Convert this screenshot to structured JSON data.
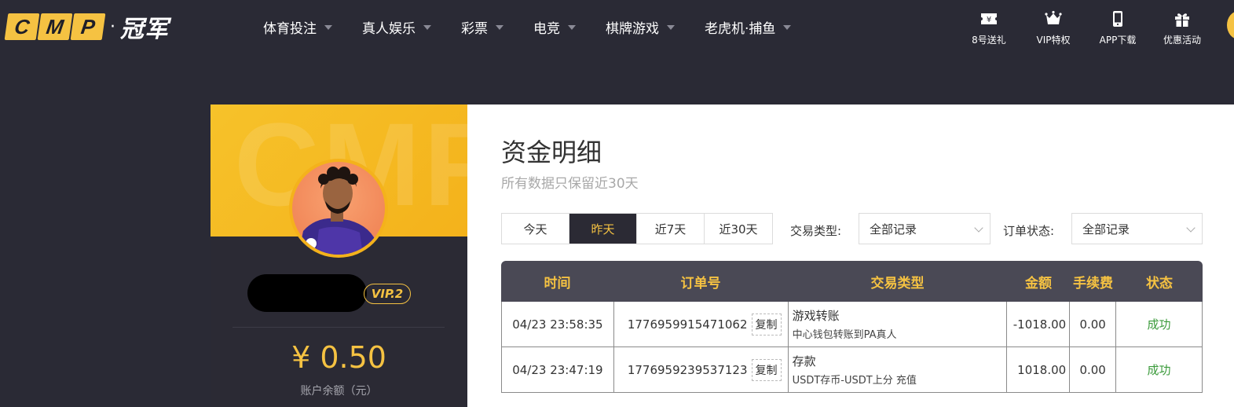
{
  "logo": {
    "letters": [
      "C",
      "M",
      "P"
    ],
    "dot": "·",
    "brand": "冠军"
  },
  "nav": [
    {
      "label": "体育投注"
    },
    {
      "label": "真人娱乐"
    },
    {
      "label": "彩票"
    },
    {
      "label": "电竞"
    },
    {
      "label": "棋牌游戏"
    },
    {
      "label": "老虎机·捕鱼"
    }
  ],
  "tools": [
    {
      "label": "8号送礼",
      "icon": "ticket-icon"
    },
    {
      "label": "VIP特权",
      "icon": "crown-icon"
    },
    {
      "label": "APP下载",
      "icon": "mobile-icon"
    },
    {
      "label": "优惠活动",
      "icon": "gift-icon"
    }
  ],
  "profile": {
    "watermark": "CMP",
    "vip": "VIP.2",
    "balance": "¥ 0.50",
    "balance_label": "账户余额（元）"
  },
  "main": {
    "title": "资金明细",
    "subtitle": "所有数据只保留近30天",
    "date_tabs": [
      {
        "label": "今天",
        "active": false
      },
      {
        "label": "昨天",
        "active": true
      },
      {
        "label": "近7天",
        "active": false
      },
      {
        "label": "近30天",
        "active": false
      }
    ],
    "filters": {
      "trade_type_label": "交易类型:",
      "trade_type_value": "全部记录",
      "order_status_label": "订单状态:",
      "order_status_value": "全部记录"
    },
    "table": {
      "headers": [
        "时间",
        "订单号",
        "交易类型",
        "金额",
        "手续费",
        "状态"
      ],
      "copy_label": "复制",
      "rows": [
        {
          "time": "04/23 23:58:35",
          "order": "1776959915471062",
          "type": "游戏转账",
          "type_detail": "中心钱包转账到PA真人",
          "amount": "-1018.00",
          "fee": "0.00",
          "status": "成功"
        },
        {
          "time": "04/23 23:47:19",
          "order": "1776959239537123",
          "type": "存款",
          "type_detail": "USDT存币-USDT上分 充值",
          "amount": "1018.00",
          "fee": "0.00",
          "status": "成功"
        }
      ]
    }
  },
  "colors": {
    "accent": "#f5c242",
    "header_bg": "#2a2a35",
    "table_head": "#4a4955",
    "success": "#3a9a3a"
  }
}
